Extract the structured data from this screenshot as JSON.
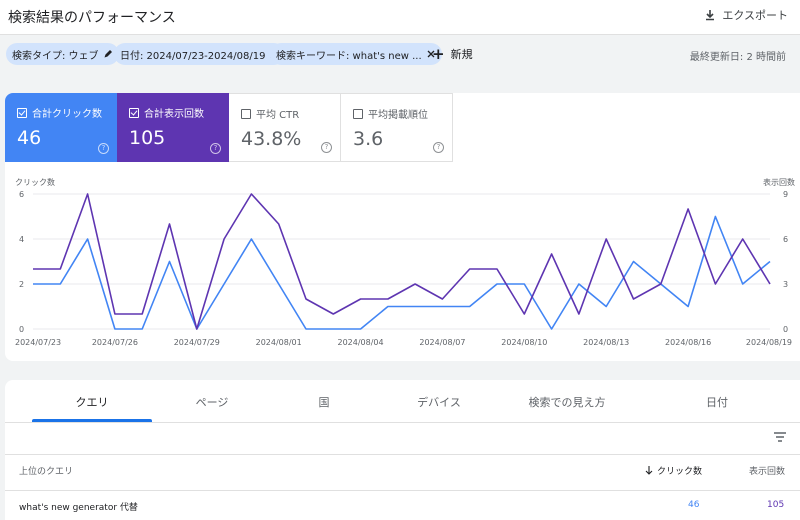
{
  "header": {
    "title": "検索結果のパフォーマンス",
    "export_label": "エクスポート"
  },
  "filters": {
    "chips": [
      {
        "label": "検索タイプ: ウェブ",
        "icon": "pencil-icon"
      },
      {
        "label": "日付: 2024/07/23-2024/08/19",
        "icon": "pencil-icon"
      },
      {
        "label": "検索キーワード: what's new ...",
        "icon": "close-icon"
      }
    ],
    "new_label": "新規",
    "updated": "最終更新日: 2 時間前"
  },
  "metrics": [
    {
      "label": "合計クリック数",
      "value": "46",
      "checked": true,
      "color": "#4285f4"
    },
    {
      "label": "合計表示回数",
      "value": "105",
      "checked": true,
      "color": "#5e35b1"
    },
    {
      "label": "平均 CTR",
      "value": "43.8%",
      "checked": false
    },
    {
      "label": "平均掲載順位",
      "value": "3.6",
      "checked": false
    }
  ],
  "chart_data": {
    "type": "line",
    "left_axis_label": "クリック数",
    "right_axis_label": "表示回数",
    "left_ticks": [
      "6",
      "4",
      "2",
      "0"
    ],
    "right_ticks": [
      "9",
      "6",
      "3",
      "0"
    ],
    "x_tick_labels": [
      "2024/07/23",
      "2024/07/26",
      "2024/07/29",
      "2024/08/01",
      "2024/08/04",
      "2024/08/07",
      "2024/08/10",
      "2024/08/13",
      "2024/08/16",
      "2024/08/19"
    ],
    "x_range": [
      "2024/07/23",
      "2024/08/19"
    ],
    "left_ylim": [
      0,
      6
    ],
    "right_ylim": [
      0,
      9
    ],
    "grid": true,
    "series": [
      {
        "name": "クリック数",
        "axis": "left",
        "color": "#4285f4",
        "values": [
          2,
          2,
          4,
          0,
          0,
          3,
          0,
          2,
          4,
          2,
          0,
          0,
          0,
          1,
          1,
          1,
          1,
          2,
          2,
          0,
          2,
          1,
          3,
          2,
          1,
          5,
          2,
          3
        ]
      },
      {
        "name": "表示回数",
        "axis": "right",
        "color": "#5e35b1",
        "values": [
          4,
          4,
          9,
          1,
          1,
          7,
          0,
          6,
          9,
          7,
          2,
          1,
          2,
          2,
          3,
          2,
          4,
          4,
          1,
          5,
          1,
          6,
          2,
          3,
          8,
          3,
          6,
          3
        ]
      }
    ]
  },
  "tabs": [
    "クエリ",
    "ページ",
    "国",
    "デバイス",
    "検索での見え方",
    "日付"
  ],
  "table": {
    "headers": {
      "query": "上位のクエリ",
      "clicks": "クリック数",
      "impressions": "表示回数"
    },
    "rows": [
      {
        "query": "what's new generator 代替",
        "clicks": "46",
        "impressions": "105"
      }
    ]
  }
}
